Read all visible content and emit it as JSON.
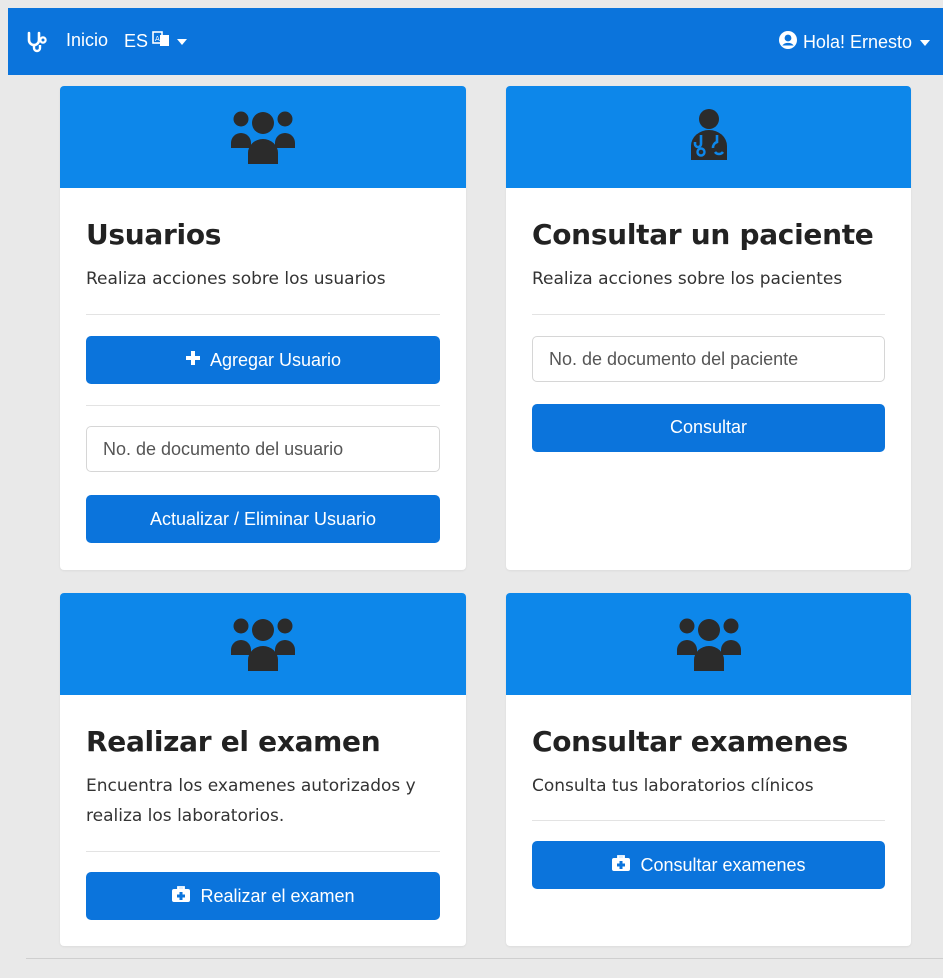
{
  "navbar": {
    "home_label": "Inicio",
    "language_label": "ES",
    "user_label": "Hola! Ernesto",
    "colors": {
      "background": "#0b74dc",
      "text": "#ffffff"
    },
    "icons": [
      "stethoscope-icon",
      "translate-icon",
      "caret-down-icon",
      "user-circle-icon"
    ]
  },
  "cards": {
    "usuarios": {
      "icon": "users-icon",
      "title": "Usuarios",
      "text": "Realiza acciones sobre los usuarios",
      "add_button": "Agregar Usuario",
      "input_placeholder": "No. de documento del usuario",
      "update_button": "Actualizar / Eliminar Usuario"
    },
    "paciente": {
      "icon": "user-doctor-icon",
      "title": "Consultar un paciente",
      "text": "Realiza acciones sobre los pacientes",
      "input_placeholder": "No. de documento del paciente",
      "button": "Consultar"
    },
    "examen": {
      "icon": "users-icon",
      "title": "Realizar el examen",
      "text": "Encuentra los examenes autorizados y realiza los laboratorios.",
      "button": "Realizar el examen",
      "button_icon": "medkit-icon"
    },
    "examenes": {
      "icon": "users-icon",
      "title": "Consultar examenes",
      "text": "Consulta tus laboratorios clínicos",
      "button": "Consultar examenes",
      "button_icon": "medkit-icon"
    }
  },
  "colors": {
    "card_header": "#0d87ea",
    "button": "#0b74dc",
    "page_background": "#e9e9e9"
  }
}
